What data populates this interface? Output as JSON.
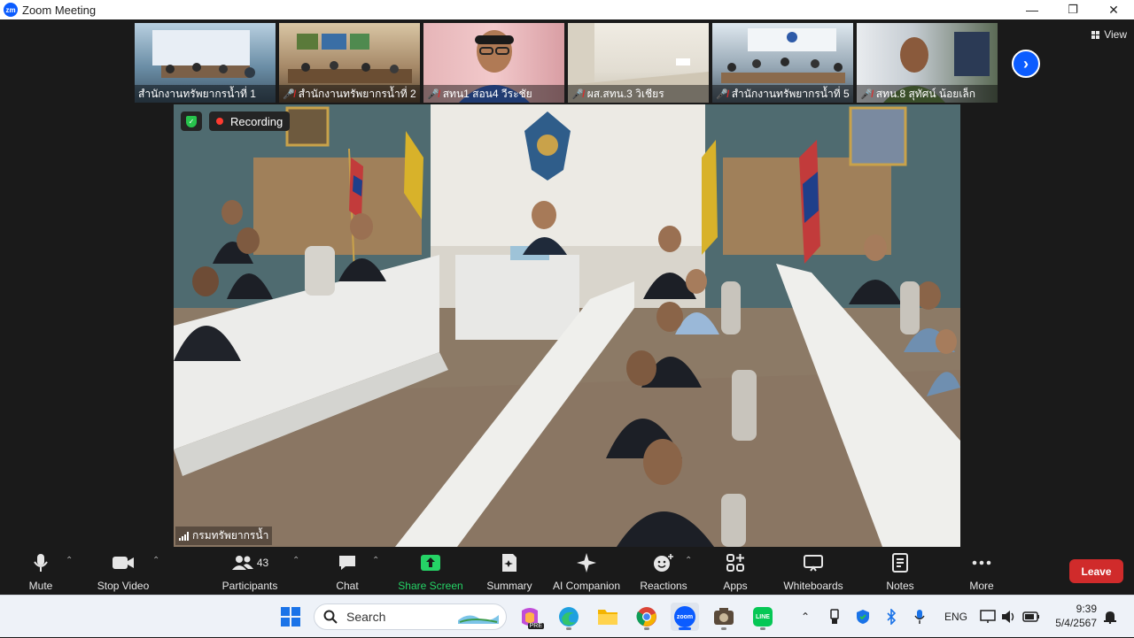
{
  "window": {
    "title": "Zoom Meeting",
    "logo_text": "zm",
    "minimize_glyph": "—",
    "maximize_glyph": "❐",
    "close_glyph": "✕"
  },
  "gallery": {
    "tiles": [
      {
        "name": "สำนักงานทรัพยากรน้ำที่ 1",
        "muted": false,
        "bg": "#6b8ea6"
      },
      {
        "name": "สำนักงานทรัพยากรน้ำที่ 2",
        "muted": true,
        "bg": "#a68968"
      },
      {
        "name": "สทน1 สอน4 วีระชัย",
        "muted": true,
        "bg": "#d99ea4"
      },
      {
        "name": "ผส.สทน.3 วิเชียร",
        "muted": true,
        "bg": "#e2ddd2"
      },
      {
        "name": "สำนักงานทรัพยากรน้ำที่ 5",
        "muted": true,
        "bg": "#97a8b5"
      },
      {
        "name": "สทน.8 สุทัศน์ น้อยเล็ก",
        "muted": true,
        "bg": "#8f9a88"
      }
    ],
    "next_glyph": "›",
    "view_label": "View"
  },
  "main_video": {
    "recording_label": "Recording",
    "speaker_name": "กรมทรัพยากรน้ำ"
  },
  "toolbar": {
    "mute": "Mute",
    "stop_video": "Stop Video",
    "participants": "Participants",
    "participants_count": "43",
    "chat": "Chat",
    "share_screen": "Share Screen",
    "summary": "Summary",
    "ai_companion": "AI Companion",
    "reactions": "Reactions",
    "apps": "Apps",
    "whiteboards": "Whiteboards",
    "notes": "Notes",
    "more": "More",
    "leave": "Leave"
  },
  "taskbar": {
    "search_placeholder": "Search",
    "language": "ENG",
    "time": "9:39",
    "date": "5/4/2567",
    "copilot_badge": "PRE",
    "zoom_label": "zoom",
    "line_label": "LINE"
  },
  "colors": {
    "zoom_blue": "#0b5cff",
    "leave_red": "#d02b2b",
    "share_green": "#25d366",
    "recording_red": "#ff3b30"
  }
}
